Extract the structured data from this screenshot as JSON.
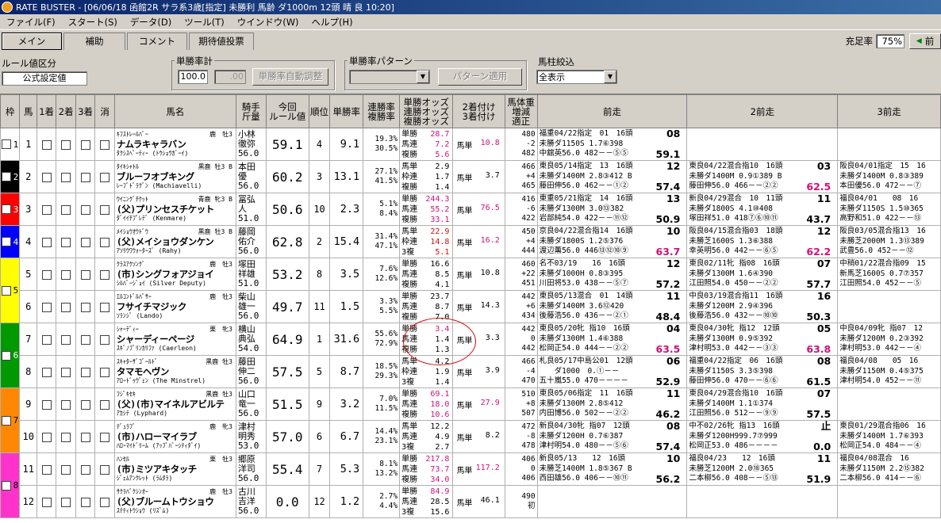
{
  "window": {
    "title": "RATE BUSTER - [06/06/18 函館2R サラ系3歳[指定] 未勝利 馬齢 ダ1000m  12頭 晴 良 10:20]"
  },
  "menu": [
    "ファイル(F)",
    "スタート(S)",
    "データ(D)",
    "ツール(T)",
    "ウインドウ(W)",
    "ヘルプ(H)"
  ],
  "tabs": [
    "メイン",
    "補助",
    "コメント",
    "期待値投票"
  ],
  "fill_rate": {
    "label": "充足率",
    "value": "75%",
    "next_label": "前"
  },
  "controls": {
    "rule_label": "ルール値区分",
    "rule_value": "公式設定値",
    "win_label": "単勝率計",
    "win_value1": "100.0",
    "win_value2": ".00",
    "auto_btn": "単勝率自動調整",
    "pattern_label": "単勝率パターン",
    "pattern_value": "",
    "apply_btn": "パターン適用",
    "filter_label": "馬柱絞込",
    "filter_value": "全表示"
  },
  "colors": {
    "waku": [
      "#ffffff",
      "#000000",
      "#ff0000",
      "#0000ff",
      "#ffff00",
      "#009900",
      "#ff8800",
      "#ff33cc"
    ]
  },
  "headers": [
    "枠",
    "馬",
    "1着",
    "2着",
    "3着",
    "消",
    "馬名",
    "騎手\n斤量",
    "今回\nルール値",
    "順位",
    "単勝率",
    "連勝率\n複勝率",
    "単勝オッズ\n連勝オッズ\n複勝オッズ",
    "2着付け\n3着付け",
    "馬体重\n増減\n適正",
    "前走",
    "2前走",
    "3前走"
  ],
  "rows": [
    {
      "waku": "1",
      "wk_text": "#000",
      "no": "1",
      "l1a": "ｷﾌｽﾄﾚｰﾙﾊﾟｰ",
      "l1b": "鹿　牡3",
      "name": "ナムラキャラバン",
      "l3": "ﾀｸｼｽﾍﾟｰﾃｨｰ (ﾄｳｼｮｳｶﾞｰｲ)",
      "j1": "小林",
      "j2": "徹弥",
      "j3": "56.0",
      "rv": "59.1",
      "rank": "4",
      "win": "9.1",
      "p1": "19.3%",
      "p2": "30.5%",
      "o1k": "単勝",
      "o1": "28.7",
      "o1c": "pink",
      "o2k": "馬連",
      "o2": "7.2",
      "o2c": "pink",
      "o3k": "複勝",
      "o3": "5.6",
      "o3c": "pink",
      "mk": "馬単",
      "mv": "10.8",
      "mc": "pink",
      "w1": "480",
      "w2": "-2",
      "w3": "482",
      "r1": [
        "福重04/22指定　01　16頭",
        "未勝ダ1150S 1.7⑥398",
        "中舘英56.0 482－－⑤⑤"
      ],
      "r1b": "08",
      "r1c": "59.1",
      "r1m": "",
      "r2": [
        "",
        "",
        ""
      ],
      "r2b": "",
      "r2c": "",
      "r2m": "",
      "r3": [
        "",
        "",
        ""
      ]
    },
    {
      "waku": "2",
      "wk_text": "#fff",
      "no": "2",
      "l1a": "ﾀｲｷｼｬﾄﾙ",
      "l1b": "黒鹿 牡3 B",
      "name": "ブルーフオブキング",
      "l3": "ﾚｰﾌﾞﾄﾞﾗｸﾞﾝ (Machiavelli)",
      "j1": "本田",
      "j2": "優",
      "j3": "56.0",
      "rv": "60.2",
      "rank": "3",
      "win": "13.1",
      "p1": "27.1%",
      "p2": "41.5%",
      "o1k": "馬単",
      "o1": "2.9",
      "o1c": "",
      "o2k": "枠連",
      "o2": "1.7",
      "o2c": "",
      "o3k": "複勝",
      "o3": "1.4",
      "o3c": "",
      "mk": "馬単",
      "mv": "3.7",
      "mc": "",
      "w1": "466",
      "w2": "+4",
      "w3": "465",
      "r1": [
        "東良05/14指定　13　16頭",
        "未勝ダ1400M 2.8③412 B",
        "藤田伸56.0 462－－①②"
      ],
      "r1b": "12",
      "r1c": "57.4",
      "r1m": "",
      "r2": [
        "東良04/22混合指10　16頭",
        "未勝ダ1400M 0.9①389 B",
        "藤田伸56.0 466－－②②"
      ],
      "r2b": "03",
      "r2c": "62.5",
      "r2m": "mag",
      "r3": [
        "阪良04/01指定　15　16",
        "未勝ダ1400M 0.8③389",
        "本田優56.0 472－－⑦"
      ]
    },
    {
      "waku": "3",
      "wk_text": "#fff",
      "no": "3",
      "l1a": "ｳｲﾆﾝｸﾞﾁｹｯﾄ",
      "l1b": "青鹿 牝3 B",
      "name": "(父)プリンセスチケット",
      "l3": "ﾀﾞｲｲﾁﾌﾟﾚﾃﾞ (Kenmare)",
      "j1": "冨弘",
      "j2": "人",
      "j3": "51.0",
      "rv": "50.6",
      "rank": "10",
      "win": "2.3",
      "p1": "5.1%",
      "p2": "8.4%",
      "o1k": "単勝",
      "o1": "244.3",
      "o1c": "pink",
      "o2k": "馬連",
      "o2": "55.2",
      "o2c": "pink",
      "o3k": "複勝",
      "o3": "33.1",
      "o3c": "pink",
      "mk": "馬単",
      "mv": "76.5",
      "mc": "pink",
      "w1": "416",
      "w2": "-6",
      "w3": "422",
      "r1": [
        "東重05/21指定　14　16頭",
        "未勝ダ1300M 3.0⑬382",
        "岩部純54.0 422－－⑪⑫"
      ],
      "r1b": "13",
      "r1c": "50.9",
      "r1m": "",
      "r2": [
        "新良04/29混合　10　11頭",
        "未勝ダ1800S 4.1⑩408",
        "塚田祥51.0 418⑦⑥⑩⑪"
      ],
      "r2b": "11",
      "r2c": "43.7",
      "r2m": "",
      "r3": [
        "福良04/01　　08　16",
        "未勝ダ1150S 1.5⑩365",
        "高野和51.0 422－－⑬"
      ]
    },
    {
      "waku": "4",
      "wk_text": "#fff",
      "no": "4",
      "l1a": "ﾒｲｼｮｳｵｳﾄﾞｳ",
      "l1b": "黒鹿 牡3 B",
      "name": "(父)メイショウダンケン",
      "l3": "ｱｿﾘｳﾜｳｫｰﾀｰｽﾞ (Rahy)",
      "j1": "藤岡",
      "j2": "佑介",
      "j3": "56.0",
      "rv": "62.8",
      "rank": "2",
      "win": "15.4",
      "p1": "31.4%",
      "p2": "47.1%",
      "o1k": "馬単",
      "o1": "22.9",
      "o1c": "red",
      "o2k": "枠連",
      "o2": "14.8",
      "o2c": "red",
      "o3k": "3複",
      "o3": "5.1",
      "o3c": "red",
      "mk": "馬単",
      "mv": "16.2",
      "mc": "pink",
      "w1": "450",
      "w2": "+4",
      "w3": "444",
      "r1": [
        "京良04/22混合指14　16頭",
        "未勝ダ1800S 1.2⑤376",
        "渡辺薫56.0 446⑬⑫⑩⑨"
      ],
      "r1b": "10",
      "r1c": "63.7",
      "r1m": "mag",
      "r2": [
        "阪良04/15混合指03　18頭",
        "未勝芝1600S 1.3⑥388",
        "幸英明56.0 442－－⑥⑤"
      ],
      "r2b": "12",
      "r2c": "62.2",
      "r2m": "mag",
      "r3": [
        "阪良03/05混合指13　16",
        "未勝芝2000M 1.3⑬389",
        "武豊56.0 452－－⑫"
      ]
    },
    {
      "waku": "5",
      "wk_text": "#000",
      "no": "5",
      "l1a": "ｸﾗｽｱｸｿﾝｸﾞ",
      "l1b": "鹿　牡3",
      "name": "(市)シングフォアジョイ",
      "l3": "ｼﾙﾊﾞｰｼﾞｮｲ (Silver Deputy)",
      "j1": "塚田",
      "j2": "祥雄",
      "j3": "51.0",
      "rv": "53.2",
      "rank": "8",
      "win": "3.5",
      "p1": "7.6%",
      "p2": "12.6%",
      "o1k": "単勝",
      "o1": "16.6",
      "o1c": "",
      "o2k": "馬連",
      "o2": "8.5",
      "o2c": "",
      "o3k": "複勝",
      "o3": "4.1",
      "o3c": "",
      "mk": "馬単",
      "mv": "10.8",
      "mc": "",
      "w1": "460",
      "w2": "+22",
      "w3": "451",
      "r1": [
        "名不03/19　　16　16頭",
        "未勝ダ1000H 0.8③395",
        "川田将53.0 438－－⑤⑦"
      ],
      "r1b": "12",
      "r1c": "57.2",
      "r1m": "",
      "r2": [
        "東良02/11牝 指08　16頭",
        "未勝ダ1300M 1.6④390",
        "江田照54.0 450－－②②"
      ],
      "r2b": "07",
      "r2c": "57.7",
      "r2m": "",
      "r3": [
        "中稍01/22混合指09　15",
        "新馬芝1600S 0.7⑦357",
        "江田照54.0 452－－⑤"
      ]
    },
    {
      "waku": "5",
      "wk_text": "#000",
      "no": "6",
      "l1a": "ｴﾙｺﾝﾄﾞﾙﾊﾟｻｰ",
      "l1b": "鹿　牡3",
      "name": "フサイチマジック",
      "l3": "ｿﾗﾝｼﾞ (Lando)",
      "j1": "柴山",
      "j2": "雄一",
      "j3": "56.0",
      "rv": "49.7",
      "rank": "11",
      "win": "1.5",
      "p1": "3.3%",
      "p2": "5.5%",
      "o1k": "単勝",
      "o1": "23.7",
      "o1c": "",
      "o2k": "馬連",
      "o2": "8.7",
      "o2c": "",
      "o3k": "複勝",
      "o3": "7.0",
      "o3c": "",
      "mk": "馬単",
      "mv": "14.3",
      "mc": "",
      "w1": "442",
      "w2": "+6",
      "w3": "434",
      "r1": [
        "東良05/13混合　01　14頭",
        "未勝ダ1400M 3.6⑫420",
        "後藤浩56.0 436－－②①"
      ],
      "r1b": "11",
      "r1c": "48.4",
      "r1m": "",
      "r2": [
        "中良03/19混合指11　16頭",
        "未勝ダ1200M 2.9④396",
        "後藤浩56.0 432－－⑩⑩"
      ],
      "r2b": "16",
      "r2c": "50.3",
      "r2m": "",
      "r3": [
        "",
        "",
        ""
      ]
    },
    {
      "waku": "6",
      "wk_text": "#fff",
      "no": "7",
      "l1a": "ｼｬｰﾃﾞｨｰ",
      "l1b": "栗　牝3",
      "name": "シャーディーページ",
      "l3": "ｽｷﾞﾉﾌﾟﾘﾝｶﾘﾌｧ (Caerleon)",
      "j1": "横山",
      "j2": "典弘",
      "j3": "54.0",
      "rv": "64.9",
      "rank": "1",
      "win": "31.6",
      "p1": "55.6%",
      "p2": "72.9%",
      "o1k": "単勝",
      "o1": "3.4",
      "o1c": "pink",
      "o2k": "馬連",
      "o2": "1.4",
      "o2c": "",
      "o3k": "複勝",
      "o3": "1.3",
      "o3c": "",
      "mk": "馬単",
      "mv": "3.3",
      "mc": "",
      "w1": "442",
      "w2": "0",
      "w3": "442",
      "r1": [
        "東良05/20牝 指10　16頭",
        "未勝ダ1300M 1.4⑥388",
        "松岡正54.0 444－－②②"
      ],
      "r1b": "04",
      "r1c": "63.5",
      "r1m": "mag",
      "r2": [
        "東良04/30牝 指12　12頭",
        "未勝ダ1300M 0.9⑤392",
        "津村明53.0 442－－③③"
      ],
      "r2b": "05",
      "r2c": "63.8",
      "r2m": "mag",
      "r3": [
        "中良04/09牝 指07　12",
        "未勝ダ1200M 0.2③392",
        "津村明53.0 442－－④"
      ]
    },
    {
      "waku": "6",
      "wk_text": "#fff",
      "no": "8",
      "l1a": "ｽｷｬﾀｰｻﾞｺﾞｰﾙﾄﾞ",
      "l1b": "黒鹿 牡3",
      "name": "タマモヘヴン",
      "l3": "ｱﾛｰﾄﾞｩｳﾞｪﾝ (The Minstrel)",
      "j1": "藤田",
      "j2": "伸二",
      "j3": "56.0",
      "rv": "57.5",
      "rank": "5",
      "win": "8.7",
      "p1": "18.5%",
      "p2": "29.3%",
      "o1k": "馬単",
      "o1": "4.2",
      "o1c": "",
      "o2k": "枠連",
      "o2": "1.9",
      "o2c": "",
      "o3k": "3複",
      "o3": "1.4",
      "o3c": "",
      "mk": "馬単",
      "mv": "3.9",
      "mc": "",
      "w1": "466",
      "w2": "-4",
      "w3": "470",
      "r1": [
        "札良05/17中島公01　12頭",
        "　　ダ1000　0.①－－",
        "五十嵐55.0 470－－－－"
      ],
      "r1b": "06",
      "r1c": "52.9",
      "r1m": "",
      "r2": [
        "福重04/22指定　06　16頭",
        "未勝ダ1150S 3.3⑤398",
        "藤田伸56.0 470－－⑥⑥"
      ],
      "r2b": "08",
      "r2c": "61.5",
      "r2m": "",
      "r3": [
        "福良04/08　　05　16",
        "未勝ダ1150M 0.4⑤375",
        "津村明54.0 452－－⑪"
      ]
    },
    {
      "waku": "7",
      "wk_text": "#000",
      "no": "9",
      "l1a": "ﾌｼﾞｷｾｷ",
      "l1b": "黒鹿 牡3",
      "name": "(父)(市)マイネルアビルテ",
      "l3": "ｱｶｼﾃ (Lyphard)",
      "j1": "山口",
      "j2": "竜一",
      "j3": "56.0",
      "rv": "51.5",
      "rank": "9",
      "win": "3.2",
      "p1": "7.0%",
      "p2": "11.5%",
      "o1k": "単勝",
      "o1": "69.1",
      "o1c": "pink",
      "o2k": "馬連",
      "o2": "18.0",
      "o2c": "pink",
      "o3k": "複勝",
      "o3": "10.6",
      "o3c": "pink",
      "mk": "馬単",
      "mv": "27.9",
      "mc": "pink",
      "w1": "510",
      "w2": "+8",
      "w3": "507",
      "r1": [
        "東良05/06指定　11　16頭",
        "未勝ダ1300M 2.8⑤412",
        "内田博56.0 502－－②②"
      ],
      "r1b": "11",
      "r1c": "46.2",
      "r1m": "",
      "r2": [
        "東良04/29混合指10　16頭",
        "未勝ダ1400M 1.1①374",
        "江田照56.0 512－－⑨⑨"
      ],
      "r2b": "07",
      "r2c": "57.5",
      "r2m": "",
      "r3": [
        "",
        "",
        ""
      ]
    },
    {
      "waku": "7",
      "wk_text": "#000",
      "no": "10",
      "l1a": "ﾃﾞｭﾗﾌﾞ",
      "l1b": "鹿　牝3",
      "name": "(市)ハローマイラブ",
      "l3": "ﾊﾛｰﾏｲﾄﾞﾘｰﾑ (ｱｯﾌﾟﾊﾞｰｼﾃｨﾀﾞｲ)",
      "j1": "津村",
      "j2": "明秀",
      "j3": "53.0",
      "rv": "57.0",
      "rank": "6",
      "win": "6.7",
      "p1": "14.4%",
      "p2": "23.1%",
      "o1k": "馬単",
      "o1": "12.2",
      "o1c": "",
      "o2k": "馬連",
      "o2": "4.9",
      "o2c": "",
      "o3k": "3複",
      "o3": "2.7",
      "o3c": "",
      "mk": "馬単",
      "mv": "8.2",
      "mc": "",
      "w1": "472",
      "w2": "-8",
      "w3": "478",
      "r1": [
        "新良04/30牝 指07　12頭",
        "未勝ダ1200H 0.7⑥387",
        "津村明54.0 480－－⑤⑥"
      ],
      "r1b": "08",
      "r1c": "57.4",
      "r1m": "",
      "r2": [
        "中不02/26牝 指13　16頭",
        "未勝ダ1200H999.7⑦999",
        "松岡正53.0 486－－－－"
      ],
      "r2b": "止",
      "r2c": "0.0",
      "r2m": "",
      "r3": [
        "東良01/29混合指06　16",
        "未勝ダ1400M 1.7⑥393",
        "松岡正54.0 484－－④"
      ]
    },
    {
      "waku": "8",
      "wk_text": "#000",
      "no": "11",
      "l1a": "ﾊﾝｾﾙ",
      "l1b": "栗　牡3",
      "name": "(市)ミツアキタッチ",
      "l3": "ｼﾞｪﾑｱﾝｸﾚｯﾄ (ﾗﾑﾀﾗ)",
      "j1": "郷原",
      "j2": "洋司",
      "j3": "56.0",
      "rv": "55.4",
      "rank": "7",
      "win": "5.3",
      "p1": "8.1%",
      "p2": "13.2%",
      "o1k": "単勝",
      "o1": "217.8",
      "o1c": "pink",
      "o2k": "馬連",
      "o2": "73.7",
      "o2c": "pink",
      "o3k": "複勝",
      "o3": "34.0",
      "o3c": "pink",
      "mk": "馬単",
      "mv": "117.2",
      "mc": "pink",
      "w1": "406",
      "w2": "0",
      "w3": "406",
      "r1": [
        "新良05/13　　12　16頭",
        "未勝芝1400M 1.8⑤367 B",
        "西田雄56.0 406－－⑩⑪"
      ],
      "r1b": "10",
      "r1c": "56.2",
      "r1m": "",
      "r2": [
        "福良04/23　　12　16頭",
        "未勝芝1200M 2.0⑱365",
        "二本柳56.0 408－－⑤⑬"
      ],
      "r2b": "11",
      "r2c": "51.9",
      "r2m": "",
      "r3": [
        "福良04/08混合　16",
        "未勝ダ1150M 2.2⑮382",
        "二本柳56.0 414－－⑥"
      ]
    },
    {
      "waku": "8",
      "wk_text": "#000",
      "no": "12",
      "l1a": "ｻｸﾗﾊﾞｸｼﾝｵｰ",
      "l1b": "鹿　牡3",
      "name": "(父)ブルームトウショウ",
      "l3": "ｽﾃﾃｨﾄｳｼｮｳ (ﾘｽﾞﾑ)",
      "j1": "古川",
      "j2": "吉洋",
      "j3": "56.0",
      "rv": "0.0",
      "rank": "12",
      "win": "1.2",
      "p1": "2.7%",
      "p2": "4.4%",
      "o1k": "単勝",
      "o1": "84.9",
      "o1c": "pink",
      "o2k": "馬連",
      "o2": "28.5",
      "o2c": "",
      "o3k": "3複",
      "o3": "15.6",
      "o3c": "",
      "mk": "馬単",
      "mv": "46.1",
      "mc": "",
      "w1": "490",
      "w2": "初",
      "w3": "",
      "r1": [
        "",
        "",
        ""
      ],
      "r1b": "",
      "r1c": "",
      "r1m": "",
      "r2": [
        "",
        "",
        ""
      ],
      "r2b": "",
      "r2c": "",
      "r2m": "",
      "r3": [
        "",
        "",
        ""
      ]
    }
  ]
}
